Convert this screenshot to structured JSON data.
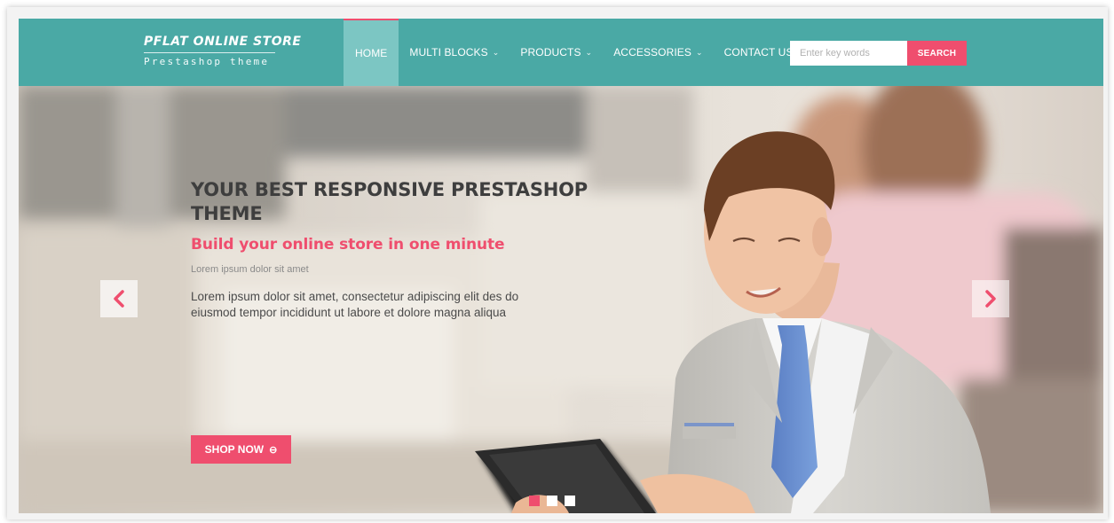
{
  "brand": {
    "title": "PFLAT ONLINE STORE",
    "subtitle": "Prestashop theme"
  },
  "nav": {
    "items": [
      {
        "label": "HOME",
        "active": true,
        "has_dropdown": false
      },
      {
        "label": "MULTI BLOCKS",
        "active": false,
        "has_dropdown": true
      },
      {
        "label": "PRODUCTS",
        "active": false,
        "has_dropdown": true
      },
      {
        "label": "ACCESSORIES",
        "active": false,
        "has_dropdown": true
      },
      {
        "label": "CONTACT US",
        "active": false,
        "has_dropdown": false
      }
    ],
    "dropdown_icon": "chevron-down-icon"
  },
  "search": {
    "placeholder": "Enter key words",
    "button_label": "SEARCH"
  },
  "slider": {
    "title": "YOUR BEST RESPONSIVE PRESTASHOP THEME",
    "subtitle": "Build your online store in one minute",
    "small_text": "Lorem ipsum dolor sit amet",
    "body": "Lorem ipsum dolor sit amet, consectetur adipiscing elit des do eiusmod tempor incididunt ut labore et dolore magna aliqua",
    "button_label": "SHOP NOW",
    "button_icon": "arrow-circle-icon",
    "prev_icon": "chevron-left-icon",
    "next_icon": "chevron-right-icon",
    "slide_count": 3,
    "active_slide": 1
  },
  "colors": {
    "header": "#4aa9a5",
    "active_nav": "#7cc6c3",
    "accent": "#ef4e6e"
  }
}
